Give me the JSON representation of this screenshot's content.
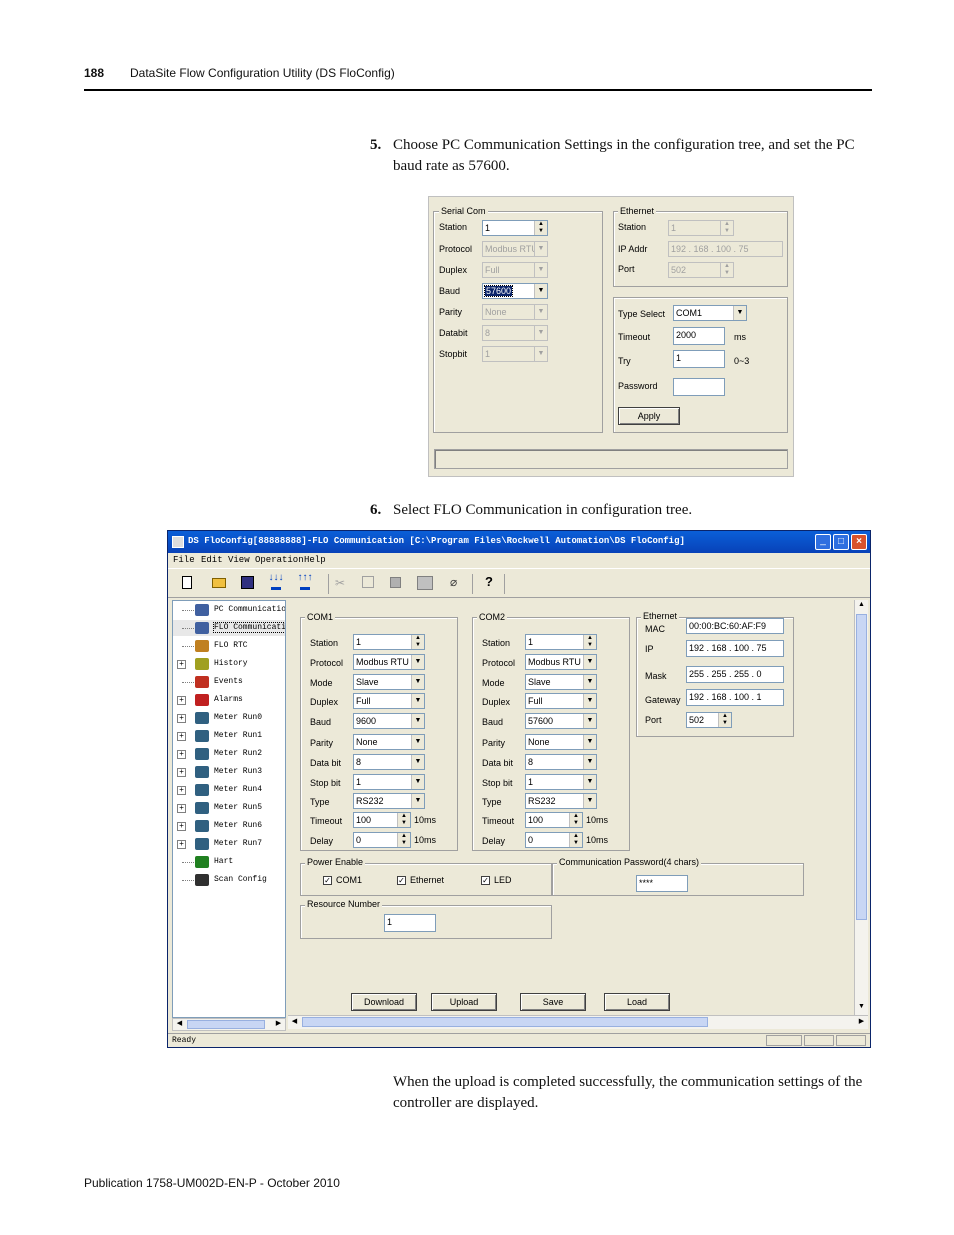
{
  "header": {
    "page_number": "188",
    "title": "DataSite Flow Configuration Utility (DS FloConfig)"
  },
  "footer": {
    "publication": "Publication 1758-UM002D-EN-P - October 2010"
  },
  "steps": [
    {
      "number": "5.",
      "text": "Choose PC Communication Settings in the configuration tree, and set the PC baud rate as 57600."
    },
    {
      "number": "6.",
      "text": "Select FLO Communication in configuration tree."
    }
  ],
  "closing_text": "When the upload is completed successfully, the communication settings of the controller are displayed.",
  "pc_dialog": {
    "serial": {
      "legend": "Serial Com",
      "rows": [
        {
          "label": "Station",
          "value": "1"
        },
        {
          "label": "Protocol",
          "value": "Modbus RTU"
        },
        {
          "label": "Duplex",
          "value": "Full"
        },
        {
          "label": "Baud",
          "value": "57600"
        },
        {
          "label": "Parity",
          "value": "None"
        },
        {
          "label": "Databit",
          "value": "8"
        },
        {
          "label": "Stopbit",
          "value": "1"
        }
      ]
    },
    "ethernet": {
      "legend": "Ethernet",
      "station_label": "Station",
      "station_value": "1",
      "ip_label": "IP Addr",
      "ip_value": "192 . 168 . 100 . 75",
      "port_label": "Port",
      "port_value": "502"
    },
    "conn": {
      "type_label": "Type Select",
      "type_value": "COM1",
      "timeout_label": "Timeout",
      "timeout_value": "2000",
      "timeout_unit": "ms",
      "try_label": "Try",
      "try_value": "1",
      "try_range": "0~3",
      "password_label": "Password",
      "password_value": "",
      "apply_label": "Apply"
    }
  },
  "app": {
    "title": "DS FloConfig[88888888]-FLO Communication [C:\\Program Files\\Rockwell Automation\\DS FloConfig]",
    "menu": [
      "File",
      "Edit",
      "View",
      "Operation",
      "Help"
    ],
    "tree": [
      {
        "label": "PC Communication",
        "icon": "computer-icon"
      },
      {
        "label": "FLO Communicatio",
        "icon": "computer-icon"
      },
      {
        "label": "FLO RTC",
        "icon": "gear-icon"
      },
      {
        "label": "History",
        "icon": "history-icon"
      },
      {
        "label": "Events",
        "icon": "events-icon"
      },
      {
        "label": "Alarms",
        "icon": "alarm-icon"
      },
      {
        "label": "Meter Run0",
        "icon": "meter-icon"
      },
      {
        "label": "Meter Run1",
        "icon": "meter-icon"
      },
      {
        "label": "Meter Run2",
        "icon": "meter-icon"
      },
      {
        "label": "Meter Run3",
        "icon": "meter-icon"
      },
      {
        "label": "Meter Run4",
        "icon": "meter-icon"
      },
      {
        "label": "Meter Run5",
        "icon": "meter-icon"
      },
      {
        "label": "Meter Run6",
        "icon": "meter-icon"
      },
      {
        "label": "Meter Run7",
        "icon": "meter-icon"
      },
      {
        "label": "Hart",
        "icon": "hart-icon"
      },
      {
        "label": "Scan Config",
        "icon": "scan-icon"
      }
    ],
    "com1": {
      "legend": "COM1",
      "rows": [
        {
          "label": "Station",
          "value": "1"
        },
        {
          "label": "Protocol",
          "value": "Modbus RTU"
        },
        {
          "label": "Mode",
          "value": "Slave"
        },
        {
          "label": "Duplex",
          "value": "Full"
        },
        {
          "label": "Baud",
          "value": "9600"
        },
        {
          "label": "Parity",
          "value": "None"
        },
        {
          "label": "Data bit",
          "value": "8"
        },
        {
          "label": "Stop bit",
          "value": "1"
        },
        {
          "label": "Type",
          "value": "RS232"
        },
        {
          "label": "Timeout",
          "value": "100"
        },
        {
          "label": "Delay",
          "value": "0"
        }
      ]
    },
    "com2": {
      "legend": "COM2",
      "rows": [
        {
          "label": "Station",
          "value": "1"
        },
        {
          "label": "Protocol",
          "value": "Modbus RTU"
        },
        {
          "label": "Mode",
          "value": "Slave"
        },
        {
          "label": "Duplex",
          "value": "Full"
        },
        {
          "label": "Baud",
          "value": "57600"
        },
        {
          "label": "Parity",
          "value": "None"
        },
        {
          "label": "Data bit",
          "value": "8"
        },
        {
          "label": "Stop bit",
          "value": "1"
        },
        {
          "label": "Type",
          "value": "RS232"
        },
        {
          "label": "Timeout",
          "value": "100"
        },
        {
          "label": "Delay",
          "value": "0"
        }
      ]
    },
    "unit_10ms": "10ms",
    "ethernet": {
      "legend": "Ethernet",
      "mac_label": "MAC",
      "mac_value": "00:00:BC:60:AF:F9",
      "ip_label": "IP",
      "ip_value": "192 . 168 . 100 . 75",
      "mask_label": "Mask",
      "mask_value": "255 . 255 . 255 . 0",
      "gateway_label": "Gateway",
      "gateway_value": "192 . 168 . 100 . 1",
      "port_label": "Port",
      "port_value": "502"
    },
    "power": {
      "legend": "Power Enable",
      "com1": "COM1",
      "ethernet": "Ethernet",
      "led": "LED"
    },
    "password": {
      "legend": "Communication Password(4 chars)",
      "value": "****"
    },
    "resource": {
      "legend": "Resource Number",
      "value": "1"
    },
    "buttons": {
      "download": "Download",
      "upload": "Upload",
      "save": "Save",
      "load": "Load"
    },
    "status": "Ready"
  }
}
